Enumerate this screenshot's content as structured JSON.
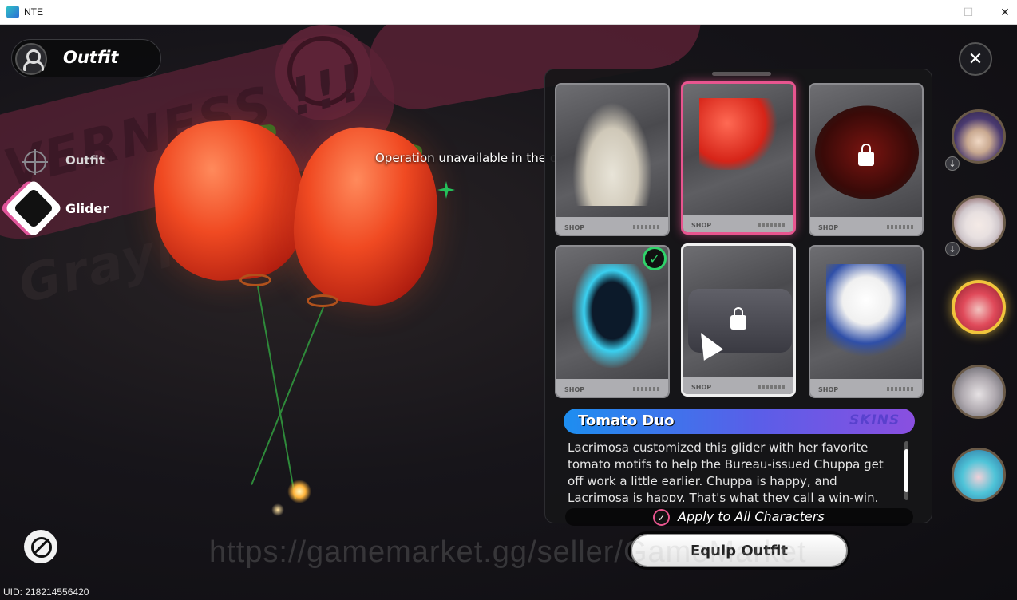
{
  "window": {
    "title": "NTE",
    "minimize": "—",
    "maximize": "☐",
    "close": "✕"
  },
  "header": {
    "title": "Outfit"
  },
  "sidebar": {
    "items": [
      {
        "label": "Outfit",
        "icon": "crosshair-icon"
      },
      {
        "label": "Glider",
        "icon": "glider-icon",
        "selected": true
      }
    ]
  },
  "background": {
    "text_1": "VERNESS !!!",
    "text_2": "Grayners"
  },
  "toast": "Operation unavailable in the current state.",
  "cards": [
    {
      "icon": "chuppa-costume-icon",
      "locked": false,
      "equipped": false,
      "selected": false,
      "tag": "SHOP"
    },
    {
      "icon": "tomato-balloon-icon",
      "locked": false,
      "equipped": false,
      "selected": true,
      "tag": "SHOP"
    },
    {
      "icon": "umbrella-icon",
      "locked": true,
      "equipped": false,
      "selected": false,
      "tag": "SHOP"
    },
    {
      "icon": "blue-flame-spirit-icon",
      "locked": false,
      "equipped": true,
      "selected": false,
      "tag": "SHOP"
    },
    {
      "icon": "police-car-icon",
      "locked": true,
      "equipped": false,
      "selected": false,
      "tag": "SHOP"
    },
    {
      "icon": "police-panda-icon",
      "locked": false,
      "equipped": false,
      "selected": false,
      "tag": "SHOP"
    }
  ],
  "item": {
    "name": "Tomato Duo",
    "rarity": "SKINS",
    "description": "Lacrimosa customized this glider with her favorite tomato motifs to help the Bureau-issued Chuppa get off work a little earlier. Chuppa is happy, and Lacrimosa is happy. That's what they call a win-win."
  },
  "apply_all": {
    "label": "Apply to All Characters",
    "checked": true,
    "check_glyph": "✓"
  },
  "equip_button": "Equip Outfit",
  "close_glyph": "✕",
  "equipped_glyph": "✓",
  "down_glyph": "↓",
  "characters": [
    {
      "icon": "character-avatar-1",
      "active": false,
      "badge": true
    },
    {
      "icon": "character-avatar-2",
      "active": false,
      "badge": true
    },
    {
      "icon": "character-avatar-3",
      "active": true,
      "badge": false
    },
    {
      "icon": "character-avatar-4",
      "active": false,
      "badge": false
    },
    {
      "icon": "character-avatar-5",
      "active": false,
      "badge": false
    }
  ],
  "uid": "UID: 218214556420",
  "watermark": "https://gamemarket.gg/seller/GameMarket",
  "colors": {
    "accent_pink": "#e8558f",
    "equipped_green": "#2fd36a",
    "active_gold": "#f0c43c",
    "title_gradient_start": "#1d8ef0",
    "title_gradient_end": "#8a4fe0"
  }
}
